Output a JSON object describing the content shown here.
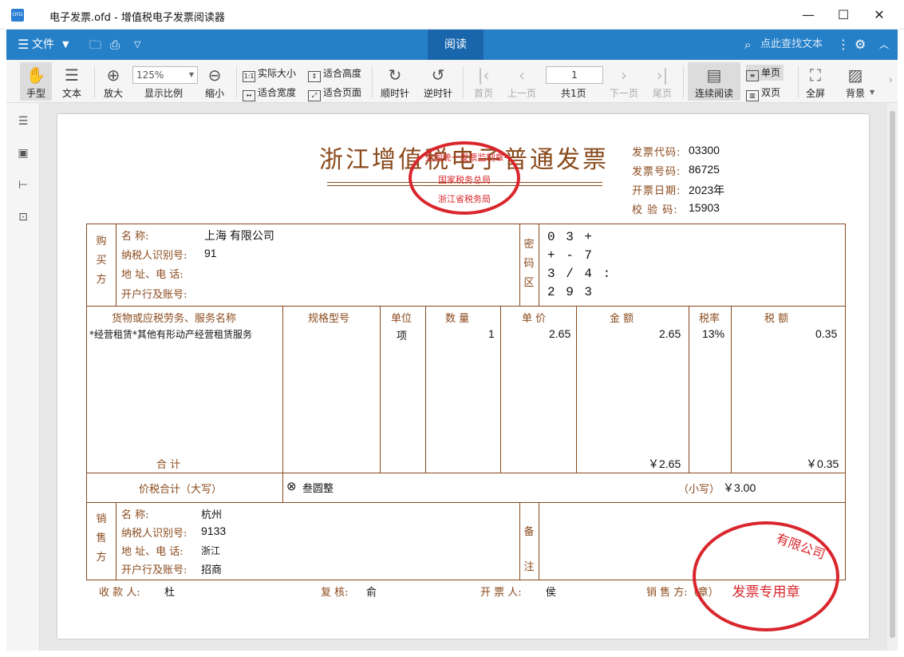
{
  "window": {
    "title": "电子发票.ofd - 增值税电子发票阅读器",
    "app_icon": "OFD",
    "minimize": "—",
    "maximize": "☐",
    "close": "✕"
  },
  "menubar": {
    "file_label": "文件",
    "active_tab": "阅读",
    "search_placeholder": "点此查找文本"
  },
  "toolbar": {
    "hand": "手型",
    "text": "文本",
    "zoom_in": "放大",
    "zoom_value": "125%",
    "zoom_ratio": "显示比例",
    "zoom_out": "缩小",
    "actual_size": "实际大小",
    "fit_width": "适合宽度",
    "fit_height": "适合高度",
    "fit_page": "适合页面",
    "rotate_cw": "顺时针",
    "rotate_ccw": "逆时针",
    "first_page": "首页",
    "prev_page": "上一页",
    "page_number": "1",
    "page_total": "共1页",
    "next_page": "下一页",
    "last_page": "尾页",
    "continuous": "连续阅读",
    "single_page": "单页",
    "double_page": "双页",
    "fullscreen": "全屏",
    "background": "背景"
  },
  "invoice": {
    "title": "浙江增值税电子普通发票",
    "meta": {
      "code_label": "发票代码:",
      "code": "03300",
      "number_label": "发票号码:",
      "number": "86725",
      "date_label": "开票日期:",
      "date": "2023年",
      "check_label": "校 验 码:",
      "check": "15903"
    },
    "buyer": {
      "side_label": [
        "购",
        "买",
        "方"
      ],
      "name_label": "名          称:",
      "name": "上海              有限公司",
      "tax_label": "纳税人识别号:",
      "tax_id": "91",
      "addr_label": "地 址、电 话:",
      "bank_label": "开户行及账号:"
    },
    "cipher_label": [
      "密",
      "码",
      "区"
    ],
    "cipher": [
      "0 3 +",
      "+ - 7",
      "3 / 4 :",
      "2 9 3"
    ],
    "columns": {
      "item": "货物或应税劳务、服务名称",
      "spec": "规格型号",
      "unit": "单位",
      "qty": "数    量",
      "price": "单    价",
      "amount": "金    额",
      "rate": "税率",
      "tax": "税    额"
    },
    "line": {
      "item": "*经营租赁*其他有形动产经营租赁服务",
      "unit": "项",
      "qty": "1",
      "price": "2.65",
      "amount": "2.65",
      "rate": "13%",
      "tax": "0.35"
    },
    "total_label": "合        计",
    "total_amount": "￥2.65",
    "total_tax": "￥0.35",
    "grand_label": "价税合计（大写）",
    "grand_upper_icon": "⊗",
    "grand_upper": "叁圆整",
    "grand_lower_label": "（小写）",
    "grand_lower": "￥3.00",
    "seller": {
      "side_label": [
        "销",
        "售",
        "方"
      ],
      "name_label": "名          称:",
      "name": "杭州",
      "tax_label": "纳税人识别号:",
      "tax_id": "9133",
      "addr_label": "地 址、电 话:",
      "addr": "浙江",
      "bank_label": "开户行及账号:",
      "bank": "招商"
    },
    "remark_label": [
      "备",
      "注"
    ],
    "footer": {
      "payee_label": "收 款 人:",
      "payee": "杜",
      "reviewer_label": "复   核:",
      "reviewer": "俞",
      "drawer_label": "开 票 人:",
      "drawer": "侯",
      "seller_label": "销 售 方:（章）"
    },
    "top_seal": {
      "top_text": "全国统一发票监制章",
      "middle_text": "国家税务总局",
      "bottom_text": "浙江省税务局"
    },
    "bottom_seal": {
      "top_text": "有限公司",
      "bottom_text": "发票专用章"
    },
    "colors": {
      "ink": "#8a4a1c",
      "seal": "#d9262c",
      "accent": "#2680c8"
    }
  }
}
